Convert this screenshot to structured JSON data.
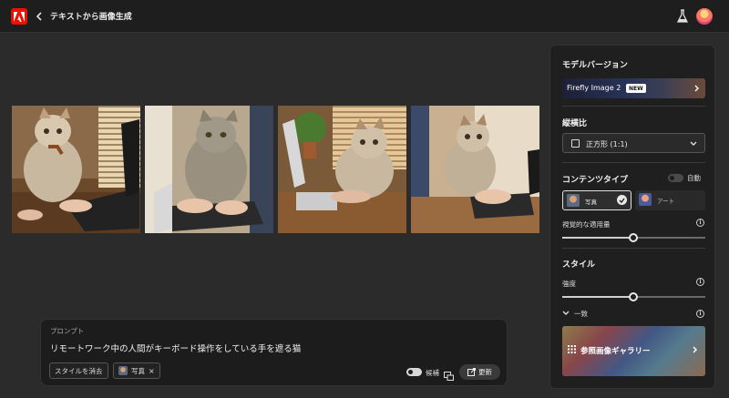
{
  "header": {
    "title": "テキストから画像生成",
    "colors": {
      "brand": "#eb1000",
      "bar": "#1e1e1e"
    }
  },
  "images": [
    {
      "alt_icon": "cat-at-laptop-photo-1"
    },
    {
      "alt_icon": "cat-at-laptop-photo-2"
    },
    {
      "alt_icon": "cat-at-laptop-photo-3"
    },
    {
      "alt_icon": "cat-at-laptop-photo-4"
    }
  ],
  "prompt": {
    "label": "プロンプト",
    "text": "リモートワーク中の人間がキーボード操作をしている手を遮る猫",
    "clear_style_label": "スタイルを消去",
    "style_chip_label": "写真",
    "candidates_label": "候補",
    "refresh_label": "更新"
  },
  "panel": {
    "model_section_title": "モデルバージョン",
    "model_name": "Firefly Image 2",
    "new_badge": "NEW",
    "aspect_section_title": "縦横比",
    "aspect_value": "正方形 (1:1)",
    "content_type_title": "コンテンツタイプ",
    "auto_label": "自動",
    "content_types": [
      {
        "label": "写真",
        "selected": true
      },
      {
        "label": "アート",
        "selected": false
      }
    ],
    "visual_intensity_label": "視覚的な適用量",
    "visual_intensity_value": 0.5,
    "style_section_title": "スタイル",
    "strength_label": "強度",
    "strength_value": 0.5,
    "match_label": "一致",
    "gallery_label": "参照画像ギャラリー"
  }
}
